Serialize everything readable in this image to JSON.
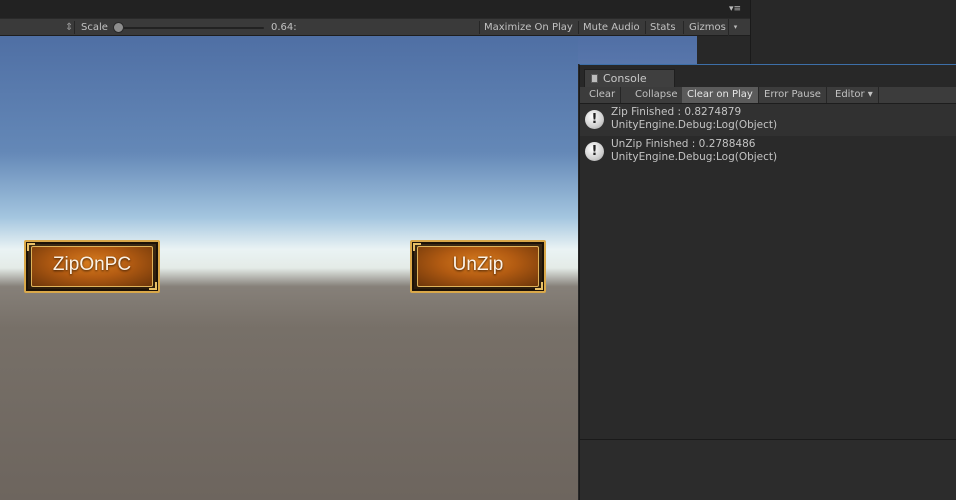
{
  "top": {
    "menu_icon": "▾≡"
  },
  "game_toolbar": {
    "resolution_arrows": "⇕",
    "scale_label": "Scale",
    "scale_value": "0.64:",
    "scale_level": 0.0,
    "maximize_label": "Maximize On Play",
    "mute_label": "Mute Audio",
    "stats_label": "Stats",
    "gizmos_label": "Gizmos",
    "gizmos_arrow": "▾"
  },
  "scene": {
    "buttons": [
      {
        "label": "ZipOnPC"
      },
      {
        "label": "UnZip"
      }
    ]
  },
  "console": {
    "tab_title": "Console",
    "tab_icon": "console-icon",
    "toolbar": {
      "clear": "Clear",
      "collapse": "Collapse",
      "clear_on_play": "Clear on Play",
      "error_pause": "Error Pause",
      "editor": "Editor ▾"
    },
    "logs": [
      {
        "icon": "info-icon",
        "message": "Zip Finished : 0.8274879",
        "trace": "UnityEngine.Debug:Log(Object)"
      },
      {
        "icon": "info-icon",
        "message": "UnZip Finished : 0.2788486",
        "trace": "UnityEngine.Debug:Log(Object)"
      }
    ]
  },
  "colors": {
    "accent_blue": "#3d6fa8",
    "button_orange": "#d87c1e",
    "button_gold": "#d9a84a"
  }
}
